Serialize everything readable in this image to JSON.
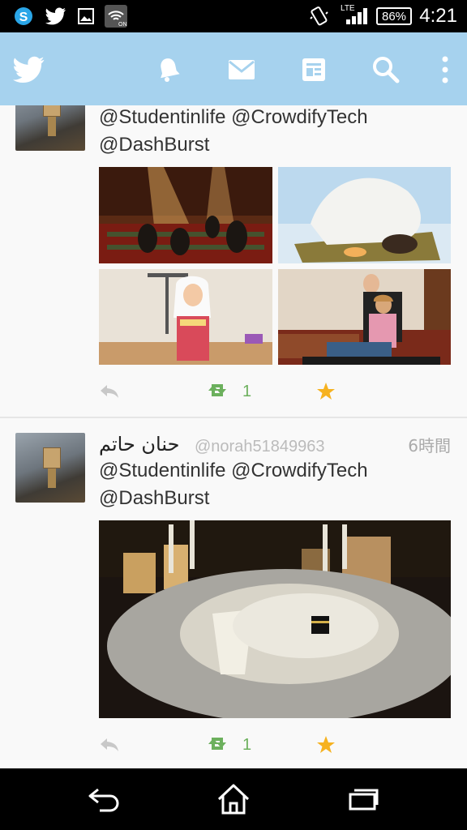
{
  "status_bar": {
    "battery": "86%",
    "network": "LTE",
    "time": "4:21"
  },
  "tweets": [
    {
      "text_line1": "@Studentinlife @CrowdifyTech",
      "text_line2": "@DashBurst",
      "retweet_count": "1"
    },
    {
      "name": "حنان حاتم",
      "handle": "@norah51849963",
      "time": "6時間",
      "text_line1": "@Studentinlife @CrowdifyTech",
      "text_line2": "@DashBurst",
      "retweet_count": "1"
    }
  ],
  "icons": {
    "app_bar": [
      "twitter-bird-icon",
      "notifications-bell-icon",
      "messages-envelope-icon",
      "lists-icon",
      "search-icon",
      "overflow-menu-icon"
    ],
    "nav_bar": [
      "back-icon",
      "home-icon",
      "recent-apps-icon"
    ]
  },
  "colors": {
    "app_bar": "#a6d2ee",
    "retweet": "#6cb05d",
    "favorite": "#f6b220",
    "reply": "#c8c8c8"
  }
}
